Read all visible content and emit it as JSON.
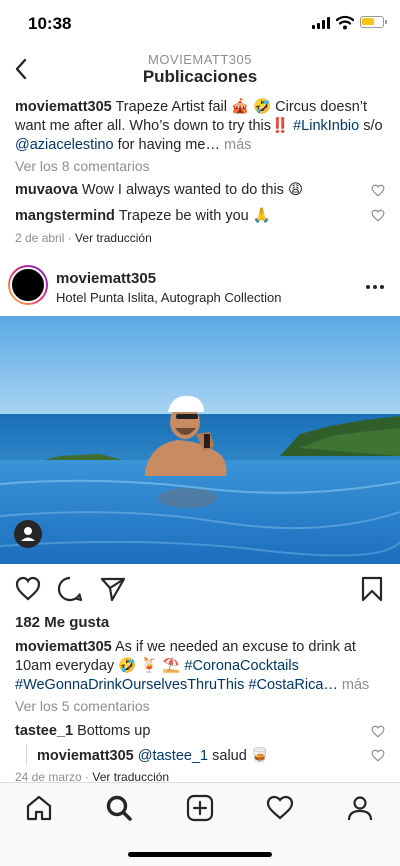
{
  "status": {
    "time": "10:38"
  },
  "header": {
    "username": "MOVIEMATT305",
    "title": "Publicaciones"
  },
  "post1": {
    "username": "moviematt305",
    "caption_text": " Trapeze Artist fail 🎪 🤣 Circus doesn’t want me after all. Who’s down to try this‼️ ",
    "hashtag": "#LinkInbio",
    "mid_text": " s/o ",
    "mention": "@aziacelestino",
    "tail_text": " for having me… ",
    "more_label": "más",
    "view_comments": "Ver los 8 comentarios",
    "comments": [
      {
        "user": "muvaova",
        "text": " Wow I always wanted to do this 😩"
      },
      {
        "user": "mangstermind",
        "text": " Trapeze be with you 🙏"
      }
    ],
    "date": "2 de abril",
    "separator": " · ",
    "translate": "Ver traducción"
  },
  "post2": {
    "username": "moviematt305",
    "location": "Hotel Punta Islita, Autograph Collection",
    "likes": "182 Me gusta",
    "caption_text": " As if we needed an excuse to drink at 10am everyday 🤣 🍹 ⛱️ ",
    "hashtag1": "#CoronaCocktails",
    "hashtag2": "#WeGonnaDrinkOurselvesThruThis",
    "hashtag3": "#CostaRica…",
    "more_label": " más",
    "view_comments": "Ver los 5 comentarios",
    "comments": [
      {
        "user": "tastee_1",
        "text": " Bottoms up"
      },
      {
        "user": "moviematt305",
        "mention": " @tastee_1",
        "text": " salud 🥃"
      }
    ],
    "date": "24 de marzo",
    "separator": " · ",
    "translate": "Ver traducción"
  },
  "icons": {
    "back": "chevron-left-icon",
    "like": "heart-icon",
    "comment": "comment-icon",
    "share": "paper-plane-icon",
    "save": "bookmark-icon",
    "home": "home-icon",
    "search": "search-icon",
    "add": "add-post-icon",
    "activity": "heart-icon",
    "profile": "profile-icon"
  },
  "colors": {
    "link": "#00376b",
    "muted": "#8e8e8e",
    "text": "#262626"
  }
}
